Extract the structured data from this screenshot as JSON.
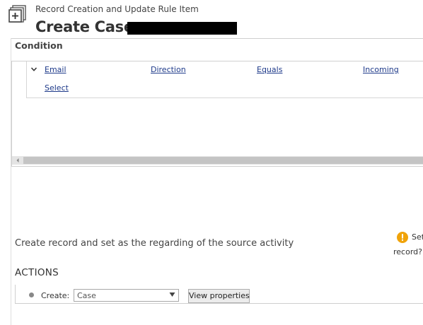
{
  "header": {
    "subtitle": "Record Creation and Update Rule Item",
    "title": "Create Case",
    "icon": "record-rule-icon"
  },
  "condition": {
    "label": "Condition",
    "columns": [
      "Email",
      "Direction",
      "Equals",
      "Incoming"
    ],
    "select_link": "Select"
  },
  "info": {
    "text": "Create record and set as the regarding of the source activity",
    "warning_text_1": "Set",
    "warning_text_2": "record?",
    "warning_color": "#f0a30a"
  },
  "actions": {
    "label": "ACTIONS",
    "create_label": "Create:",
    "create_value": "Case",
    "view_properties": "View properties"
  }
}
